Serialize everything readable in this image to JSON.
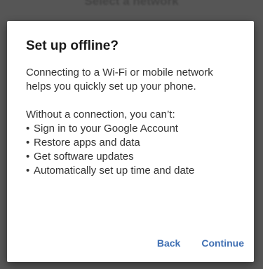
{
  "background": {
    "title": "Select a network"
  },
  "dialog": {
    "title": "Set up offline?",
    "intro": "Connecting to a Wi-Fi or mobile network helps you quickly set up your phone.",
    "limits_heading": "Without a connection, you can’t:",
    "limits": [
      "Sign in to your Google Account",
      "Restore apps and data",
      "Get software updates",
      "Automatically set up time and date"
    ],
    "back_label": "Back",
    "continue_label": "Continue"
  },
  "colors": {
    "accent": "#3f6fb3",
    "scrim": "#6f6f6f",
    "surface": "#ffffff"
  }
}
